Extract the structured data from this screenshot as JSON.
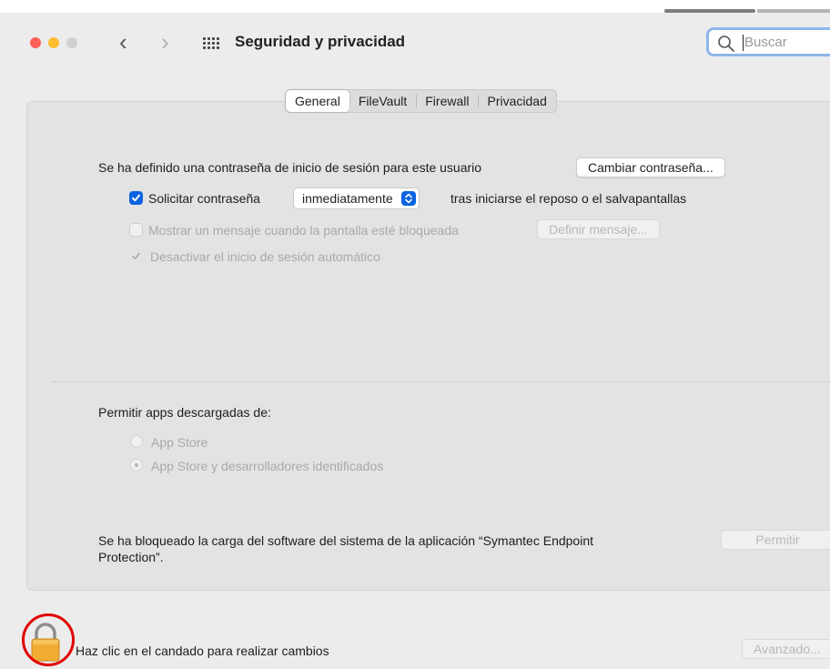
{
  "window": {
    "title": "Seguridad y privacidad",
    "search_placeholder": "Buscar"
  },
  "icons": {
    "back": "chevron-left-icon",
    "forward": "chevron-right-icon",
    "grid": "grid-icon",
    "search": "search-icon",
    "lock": "lock-icon"
  },
  "tabs": [
    {
      "label": "General",
      "selected": true
    },
    {
      "label": "FileVault",
      "selected": false
    },
    {
      "label": "Firewall",
      "selected": false
    },
    {
      "label": "Privacidad",
      "selected": false
    }
  ],
  "general": {
    "password_text": "Se ha definido una contraseña de inicio de sesión para este usuario",
    "change_password_button": "Cambiar contraseña...",
    "require_password": {
      "checked": true,
      "label": "Solicitar contraseña",
      "select_value": "inmediatamente",
      "after_text": "tras iniciarse el reposo o el salvapantallas"
    },
    "show_message": {
      "checked": false,
      "enabled": false,
      "label": "Mostrar un mensaje cuando la pantalla esté bloqueada",
      "button": "Definir mensaje..."
    },
    "disable_autologin": {
      "checked": true,
      "enabled": false,
      "label": "Desactivar el inicio de sesión automático"
    },
    "allow_apps": {
      "heading": "Permitir apps descargadas de:",
      "options": [
        {
          "label": "App Store",
          "selected": false
        },
        {
          "label": "App Store y desarrolladores identificados",
          "selected": true
        }
      ]
    },
    "blocked_software": {
      "text_line1": "Se ha bloqueado la carga del software del sistema de la aplicación “Symantec Endpoint",
      "text_line2": "Protection”.",
      "button": "Permitir"
    }
  },
  "footer": {
    "lock_text": "Haz clic en el candado para realizar cambios",
    "advanced_button": "Avanzado..."
  },
  "colors": {
    "accent": "#0a63e0",
    "annotation": "#e10000",
    "lock": "#f1ad33"
  }
}
